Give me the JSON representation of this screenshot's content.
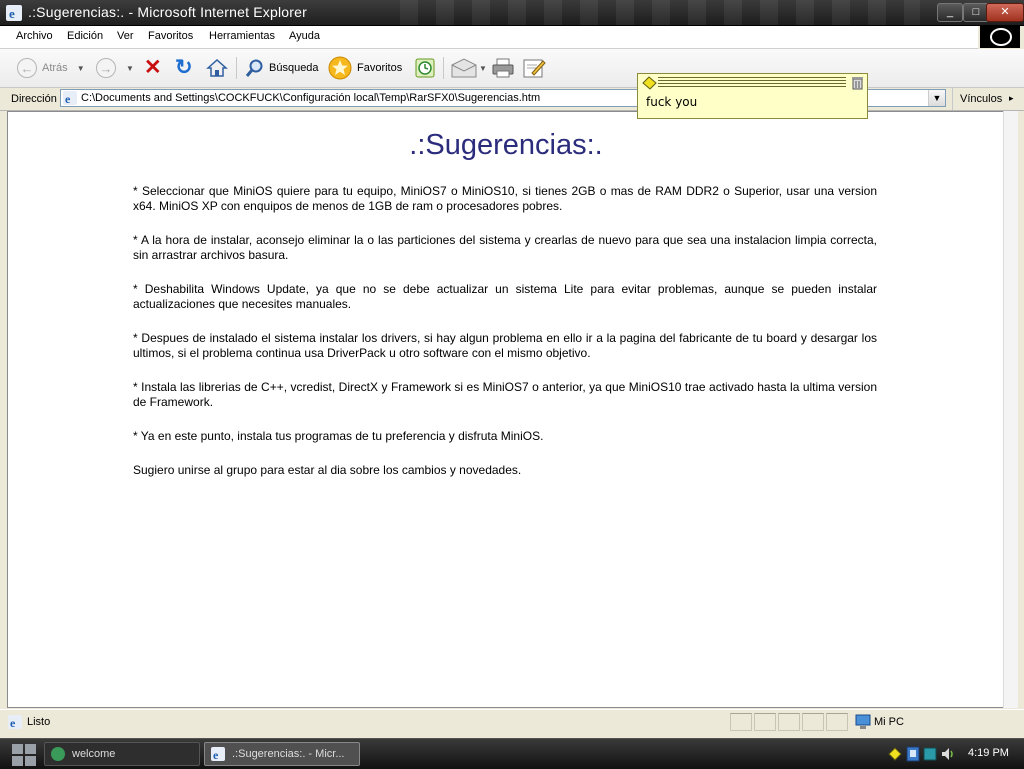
{
  "window": {
    "title": ".:Sugerencias:. - Microsoft Internet Explorer",
    "accent": "#2c2c7d"
  },
  "menu": [
    "Archivo",
    "Edición",
    "Ver",
    "Favoritos",
    "Herramientas",
    "Ayuda"
  ],
  "toolbar": {
    "back_label": "Atrás",
    "search_label": "Búsqueda",
    "favorites_label": "Favoritos"
  },
  "address": {
    "label": "Dirección",
    "url": "C:\\Documents and Settings\\COCKFUCK\\Configuración local\\Temp\\RarSFX0\\Sugerencias.htm",
    "links_label": "Vínculos"
  },
  "page": {
    "heading": ".:Sugerencias:.",
    "paragraphs": [
      "* Seleccionar que MiniOS quiere para tu equipo, MiniOS7 o MiniOS10, si tienes 2GB o mas de RAM DDR2 o Superior, usar una version x64. MiniOS XP con enquipos de menos de 1GB de ram o procesadores pobres.",
      "* A la hora de instalar, aconsejo eliminar la o las particiones del sistema y crearlas de nuevo para que sea una instalacion limpia correcta, sin arrastrar archivos basura.",
      "* Deshabilita Windows Update, ya que no se debe actualizar un sistema Lite para evitar problemas, aunque se pueden instalar actualizaciones que necesites manuales.",
      "* Despues de instalado el sistema instalar los drivers, si hay algun problema en ello ir a la pagina del fabricante de tu board y desargar los ultimos, si el problema continua usa DriverPack u otro software con el mismo objetivo.",
      "* Instala las librerias de C++, vcredist, DirectX y Framework si es MiniOS7 o anterior, ya que MiniOS10 trae activado hasta la ultima version de Framework.",
      "* Ya en este punto, instala tus programas de tu preferencia y disfruta MiniOS.",
      "Sugiero unirse al grupo para estar al dia sobre los cambios y novedades."
    ]
  },
  "sticky_note": {
    "text": "fuck you"
  },
  "status": {
    "text": "Listo",
    "zone": "Mi PC"
  },
  "taskbar": {
    "tasks": [
      "welcome",
      ".:Sugerencias:. - Micr..."
    ],
    "clock": "4:19 PM"
  }
}
